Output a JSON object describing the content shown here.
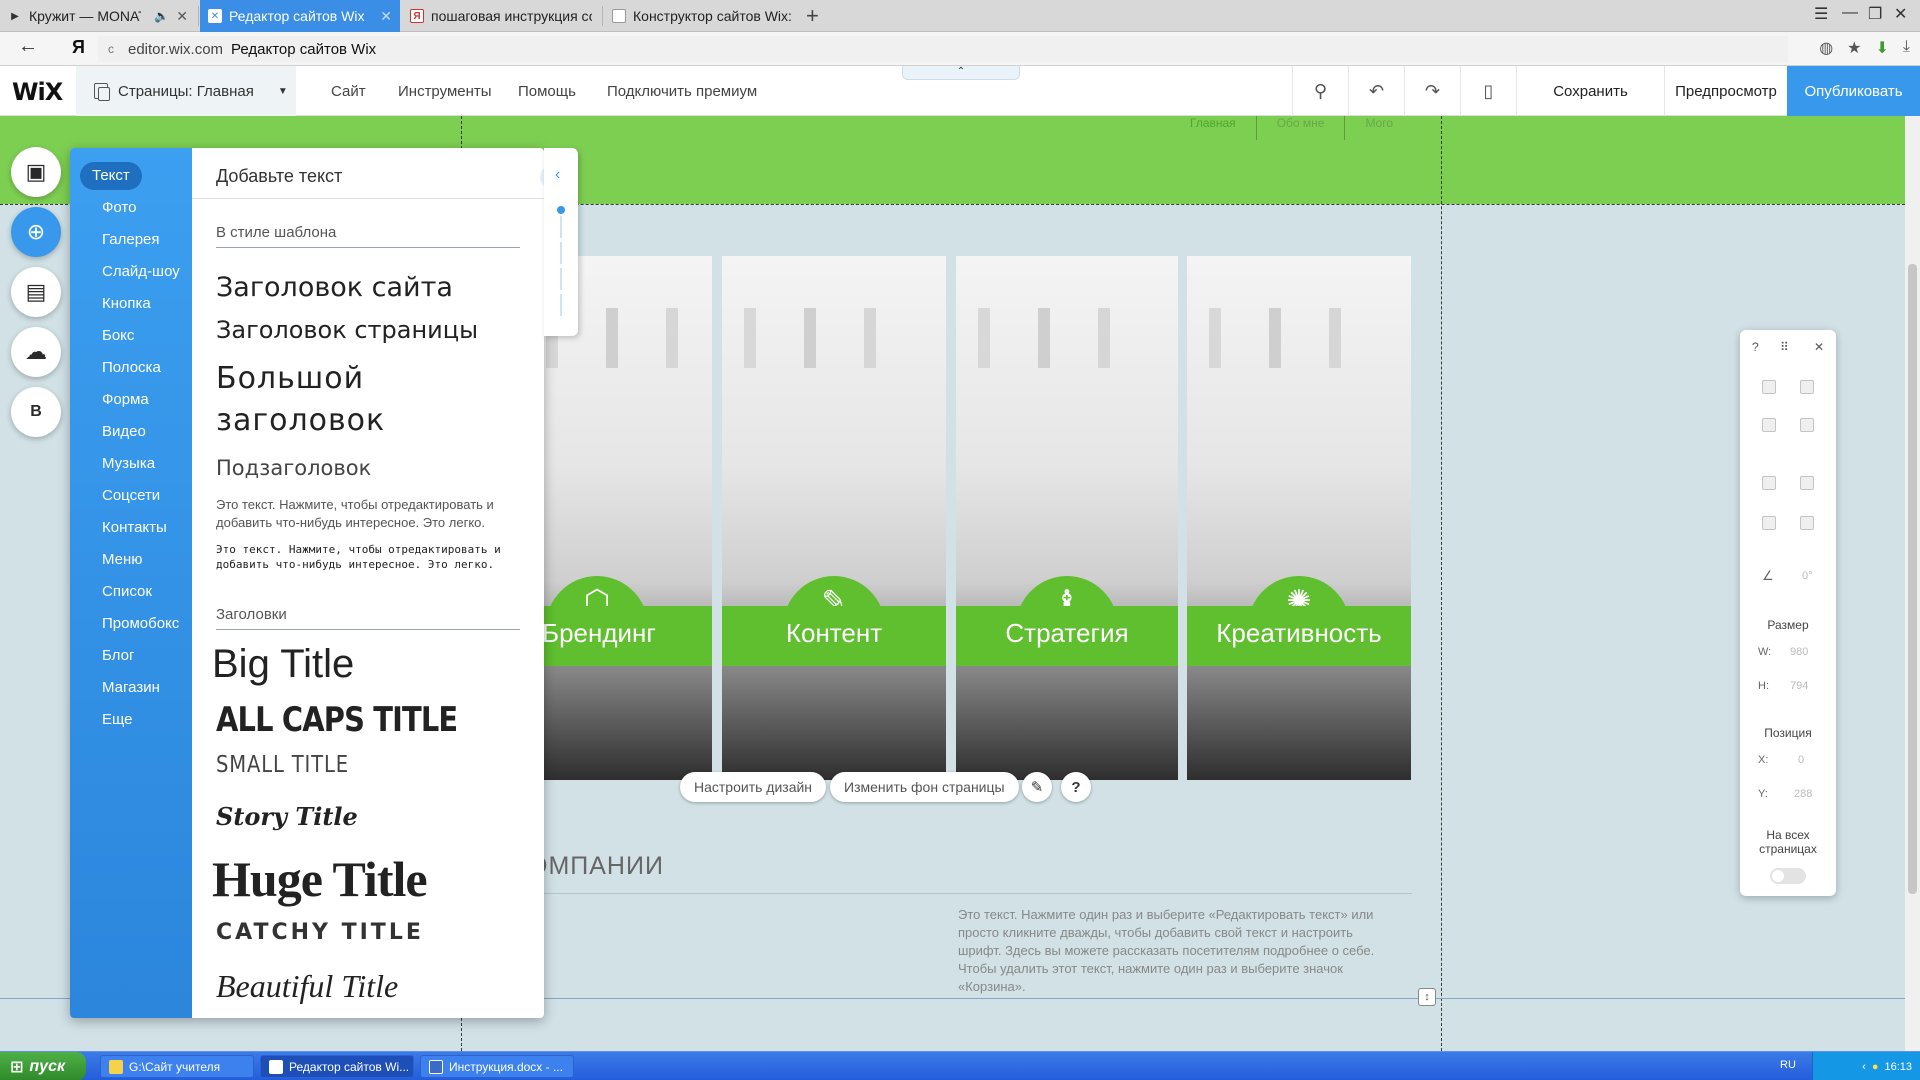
{
  "browser": {
    "tabs": [
      {
        "title": "Кружит — MONATIK",
        "icon": "play-icon"
      },
      {
        "title": "Редактор сайтов Wix",
        "icon": "wix-favicon",
        "active": true
      },
      {
        "title": "пошаговая инструкция соз",
        "icon": "yandex-favicon"
      },
      {
        "title": "Конструктор сайтов Wix: ка",
        "icon": "page-favicon"
      }
    ],
    "new_tab": "+",
    "yandex_logo": "Я",
    "url_domain": "editor.wix.com",
    "url_title": "Редактор сайтов Wix"
  },
  "wix": {
    "logo": "WiX",
    "pages_label": "Страницы: Главная",
    "menu": [
      "Сайт",
      "Инструменты",
      "Помощь",
      "Подключить премиум"
    ],
    "save": "Сохранить",
    "preview": "Предпросмотр",
    "publish": "Опубликовать"
  },
  "site": {
    "nav": [
      "Главная",
      "Обо мне",
      "Мого"
    ],
    "gallery": [
      {
        "title": "Брендинг",
        "icon": "box-icon"
      },
      {
        "title": "Контент",
        "icon": "pencil-icon"
      },
      {
        "title": "Стратегия",
        "icon": "chess-icon"
      },
      {
        "title": "Креативность",
        "icon": "lightbulb-icon"
      }
    ],
    "design_btn": "Настроить дизайн",
    "bg_btn": "Изменить фон страницы",
    "section_heading": "ОМПАНИИ",
    "about_text": "Это текст. Нажмите один раз и выберите «Редактировать текст» или просто кликните дважды, чтобы добавить свой текст и настроить шрифт. Здесь вы можете рассказать посетителям подробнее о себе. Чтобы удалить этот текст, нажмите один раз и выберите значок «Корзина»."
  },
  "add_panel": {
    "categories": [
      "Текст",
      "Фото",
      "Галерея",
      "Слайд-шоу",
      "Кнопка",
      "Бокс",
      "Полоска",
      "Форма",
      "Видео",
      "Музыка",
      "Соцсети",
      "Контакты",
      "Меню",
      "Список",
      "Промобокс",
      "Блог",
      "Магазин",
      "Еще"
    ],
    "title": "Добавьте текст",
    "help": "?",
    "close": "×",
    "section_theme": "В стиле шаблона",
    "site_title": "Заголовок сайта",
    "page_title": "Заголовок страницы",
    "big_title": "Большой заголовок",
    "subtitle": "Подзаголовок",
    "paragraph1": "Это текст. Нажмите, чтобы отредактировать и добавить что-нибудь интересное. Это легко.",
    "paragraph2": "Это текст. Нажмите, чтобы отредактировать и добавить что-нибудь интересное. Это легко.",
    "section_titles": "Заголовки",
    "titles": [
      "Big Title",
      "ALL CAPS TITLE",
      "SMALL TITLE",
      "Story Title",
      "Huge Title",
      "CATCHY TITLE",
      "Beautiful Title"
    ]
  },
  "inspector": {
    "size_label": "Размер",
    "w_label": "W:",
    "w_value": "980",
    "h_label": "H:",
    "h_value": "794",
    "position_label": "Позиция",
    "x_label": "X:",
    "x_value": "0",
    "y_label": "Y:",
    "y_value": "288",
    "angle_value": "0°",
    "all_pages_label": "На всех страницах"
  },
  "taskbar": {
    "start": "пуск",
    "tasks": [
      "G:\\Сайт учителя",
      "Редактор сайтов Wi...",
      "Инструкция.docx - ..."
    ],
    "lang": "RU",
    "time": "16:13"
  },
  "colors": {
    "wix_blue": "#3899ec",
    "header_green": "#7dcf52",
    "badge_green": "#5fbf2e",
    "canvas_bg": "#d1e1e6"
  }
}
